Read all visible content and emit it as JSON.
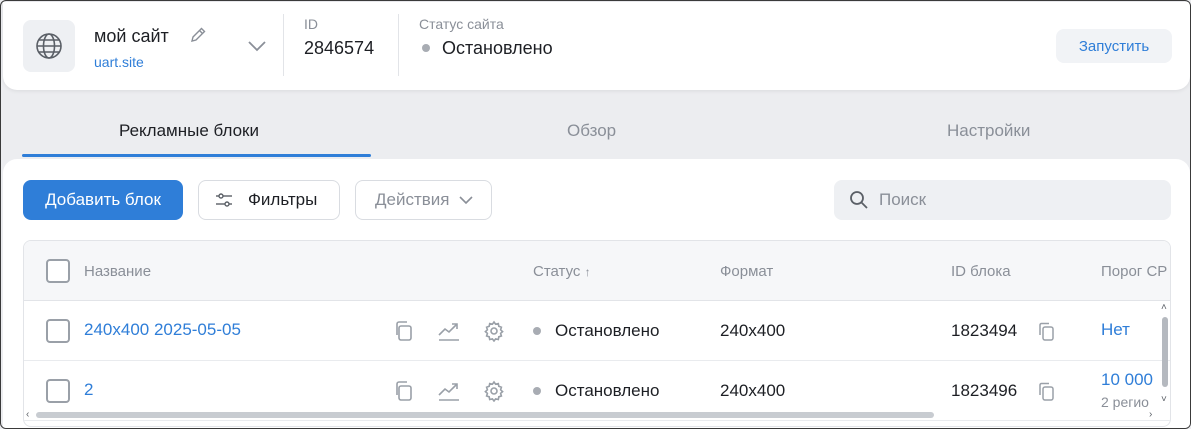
{
  "header": {
    "site_name": "мой сайт",
    "site_url": "uart.site",
    "id_label": "ID",
    "id_value": "2846574",
    "status_label": "Статус сайта",
    "status_value": "Остановлено",
    "launch_button": "Запустить",
    "icons": [
      "globe-icon",
      "pencil-icon",
      "chevron-down-icon"
    ]
  },
  "tabs": [
    {
      "label": "Рекламные блоки",
      "active": true
    },
    {
      "label": "Обзор",
      "active": false
    },
    {
      "label": "Настройки",
      "active": false
    }
  ],
  "toolbar": {
    "add_button": "Добавить блок",
    "filters_button": "Фильтры",
    "actions_dropdown": "Действия",
    "search_placeholder": "Поиск"
  },
  "table": {
    "columns": [
      "Название",
      "Статус",
      "Формат",
      "ID блока",
      "Порог CP"
    ],
    "sort_indicator": "↑",
    "rows": [
      {
        "name": "240x400 2025-05-05",
        "status": "Остановлено",
        "format": "240x400",
        "block_id": "1823494",
        "threshold": "Нет",
        "threshold_sub": ""
      },
      {
        "name": "2",
        "status": "Остановлено",
        "format": "240x400",
        "block_id": "1823496",
        "threshold": "10 000",
        "threshold_sub": "2 регио"
      }
    ]
  },
  "colors": {
    "accent": "#2f7ed8",
    "status_stopped": "#a8acb3",
    "background": "#ecedf0"
  }
}
